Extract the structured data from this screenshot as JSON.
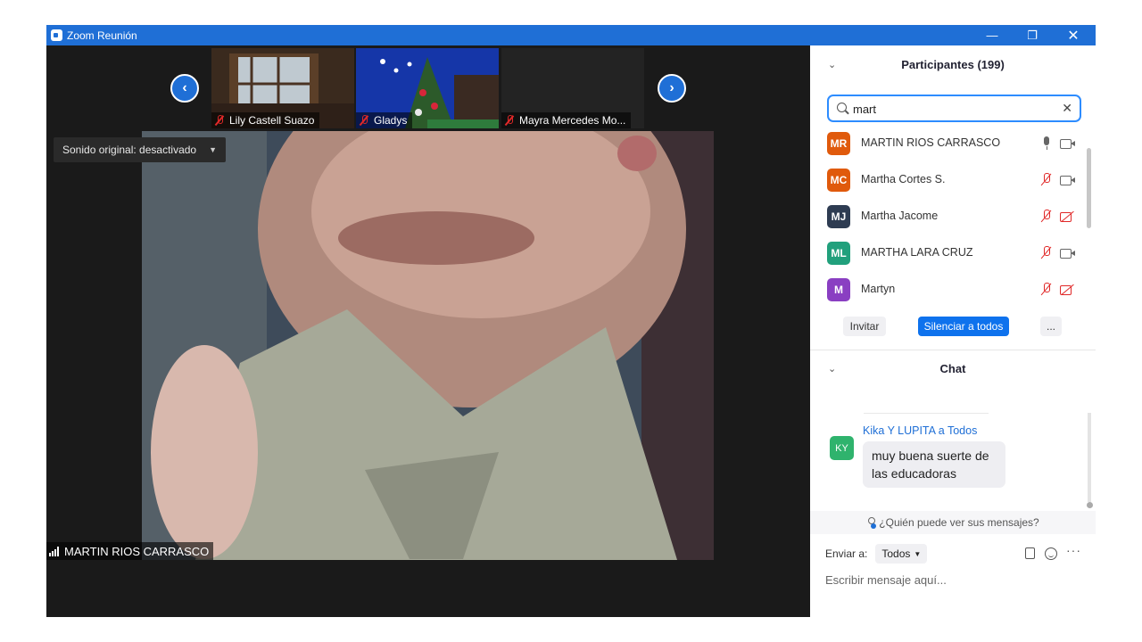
{
  "window": {
    "title": "Zoom Reunión"
  },
  "thumbnails": [
    {
      "name": "Lily Castell Suazo"
    },
    {
      "name": "Gladys"
    },
    {
      "name": "Mayra Mercedes Mo..."
    }
  ],
  "sound_badge": {
    "label": "Sonido original: desactivado"
  },
  "speaker": {
    "name": "MARTIN RIOS CARRASCO"
  },
  "participants": {
    "header": "Participantes (199)",
    "search_value": "mart",
    "items": [
      {
        "initials": "MR",
        "name": "MARTIN RIOS CARRASCO",
        "color": "#e05a0c",
        "mic": "on",
        "cam": "on"
      },
      {
        "initials": "MC",
        "name": "Martha Cortes S.",
        "color": "#e05a0c",
        "mic": "off",
        "cam": "on"
      },
      {
        "initials": "MJ",
        "name": "Martha Jacome",
        "color": "#2e3c52",
        "mic": "off",
        "cam": "off"
      },
      {
        "initials": "ML",
        "name": "MARTHA LARA CRUZ",
        "color": "#21a07c",
        "mic": "off",
        "cam": "on"
      },
      {
        "initials": "M",
        "name": "Martyn",
        "color": "#8a3fc2",
        "mic": "off",
        "cam": "off"
      }
    ],
    "invite_label": "Invitar",
    "mute_all_label": "Silenciar a todos",
    "more_label": "..."
  },
  "chat": {
    "header": "Chat",
    "message": {
      "avatar": "KY",
      "sender": "Kika Y LUPITA a Todos",
      "text": "muy buena suerte de las educadoras"
    },
    "who_can_see": "¿Quién puede ver sus mensajes?",
    "send_to_label": "Enviar a:",
    "send_to_value": "Todos",
    "input_placeholder": "Escribir mensaje aquí..."
  },
  "colors": {
    "accent": "#0e72ed",
    "titlebar": "#1f6fd6",
    "muted_red": "#e02828"
  }
}
